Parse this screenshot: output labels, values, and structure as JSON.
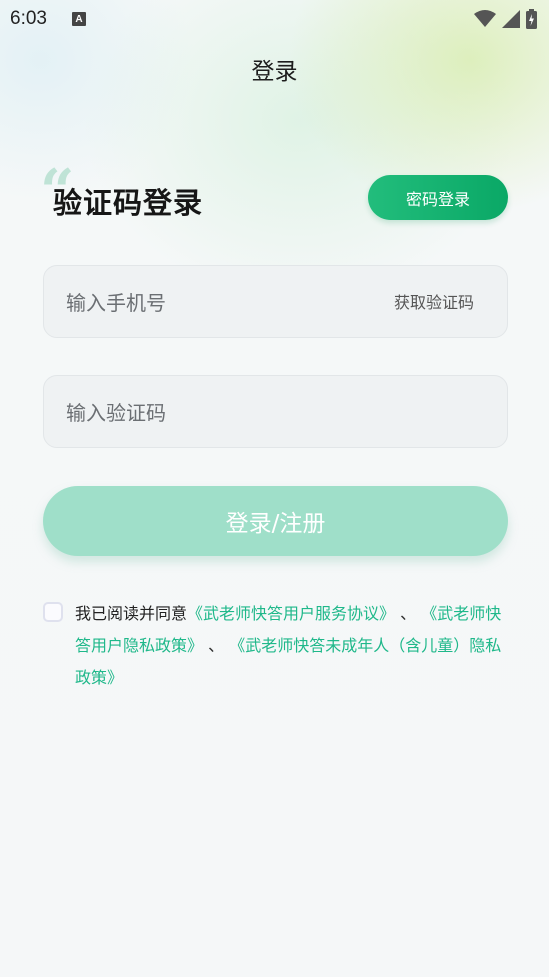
{
  "status_bar": {
    "time": "6:03",
    "notification_icon": "A"
  },
  "page_title": "登录",
  "login_form": {
    "heading": "验证码登录",
    "password_login_button": "密码登录",
    "phone_placeholder": "输入手机号",
    "get_code_label": "获取验证码",
    "code_placeholder": "输入验证码",
    "submit_label": "登录/注册"
  },
  "agreement": {
    "prefix": "我已阅读并同意",
    "link_service": "《武老师快答用户服务协议》",
    "separator_1": " 、 ",
    "link_privacy": "《武老师快答用户隐私政策》",
    "separator_2": " 、 ",
    "link_minor": "《武老师快答未成年人（含儿童）隐私政策》"
  },
  "colors": {
    "accent": "#0fb06e",
    "button_disabled": "#9fdfc9",
    "link": "#1fb88a"
  },
  "icons": [
    "notification-a-icon",
    "wifi-icon",
    "signal-icon",
    "battery-icon",
    "quote-mark-icon"
  ]
}
